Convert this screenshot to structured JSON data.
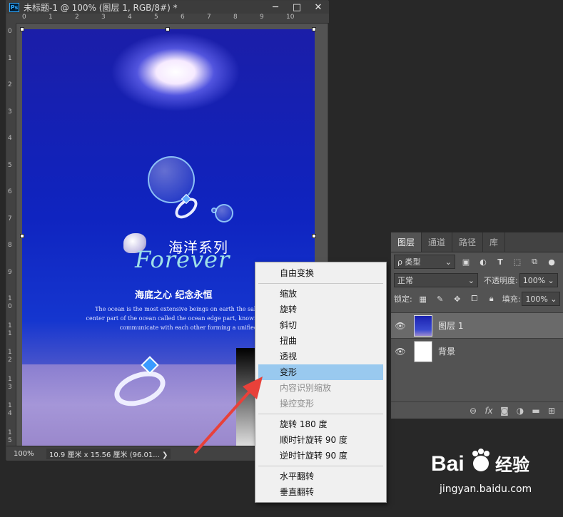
{
  "document": {
    "title": "未标题-1 @ 100% (图层 1, RGB/8#) *",
    "app_icon": "Ps",
    "window_buttons": [
      "─",
      "□",
      "✕"
    ],
    "ruler_top_labels": [
      "0",
      "1",
      "2",
      "3",
      "4",
      "5",
      "6",
      "7",
      "8",
      "9",
      "10"
    ],
    "ruler_left_labels": [
      "0",
      "1",
      "2",
      "3",
      "4",
      "5",
      "6",
      "7",
      "8",
      "9",
      "1\n0",
      "1\n1",
      "1\n2",
      "1\n3",
      "1\n4",
      "1\n5"
    ],
    "status": {
      "zoom": "100%",
      "doc_info": "10.9 厘米 x 15.56 厘米 (96.01... ❯"
    }
  },
  "poster": {
    "title_cn": "海洋系列",
    "title_en": "Forever",
    "subtitle": "海底之心  纪念永恒",
    "paragraph": "The ocean is the most extensive beings on earth the salt water, the center part of the ocean called the ocean edge part, known as the sea, to communicate with each other forming a unified w"
  },
  "layers_panel": {
    "tabs": [
      {
        "label": "图层",
        "active": true
      },
      {
        "label": "通道",
        "active": false
      },
      {
        "label": "路径",
        "active": false
      },
      {
        "label": "库",
        "active": false
      }
    ],
    "filter": {
      "label": "ρ 类型",
      "icons": [
        "image-icon",
        "adjust-icon",
        "text-icon",
        "shape-icon",
        "smart-object-icon"
      ]
    },
    "blend_mode": "正常",
    "opacity_label": "不透明度:",
    "opacity_value": "100%",
    "lock_label": "锁定:",
    "fill_label": "填充:",
    "fill_value": "100%",
    "layers": [
      {
        "name": "图层 1",
        "visible": true,
        "selected": true
      },
      {
        "name": "背景",
        "visible": true,
        "selected": false
      }
    ]
  },
  "context_menu": {
    "items": [
      {
        "label": "自由变换",
        "state": "normal"
      },
      {
        "sep": true
      },
      {
        "label": "缩放",
        "state": "normal"
      },
      {
        "label": "旋转",
        "state": "normal"
      },
      {
        "label": "斜切",
        "state": "normal"
      },
      {
        "label": "扭曲",
        "state": "normal"
      },
      {
        "label": "透视",
        "state": "normal"
      },
      {
        "label": "变形",
        "state": "highlighted"
      },
      {
        "label": "内容识别缩放",
        "state": "disabled"
      },
      {
        "label": "操控变形",
        "state": "disabled"
      },
      {
        "sep": true
      },
      {
        "label": "旋转 180 度",
        "state": "normal"
      },
      {
        "label": "顺时针旋转 90 度",
        "state": "normal"
      },
      {
        "label": "逆时针旋转 90 度",
        "state": "normal"
      },
      {
        "sep": true
      },
      {
        "label": "水平翻转",
        "state": "normal"
      },
      {
        "label": "垂直翻转",
        "state": "normal"
      }
    ]
  },
  "watermark": {
    "logo": "Bai 经验",
    "url": "jingyan.baidu.com"
  },
  "colors": {
    "highlight": "#99c9ef",
    "arrow": "#e8413a",
    "ps_blue": "#31a8ff"
  }
}
